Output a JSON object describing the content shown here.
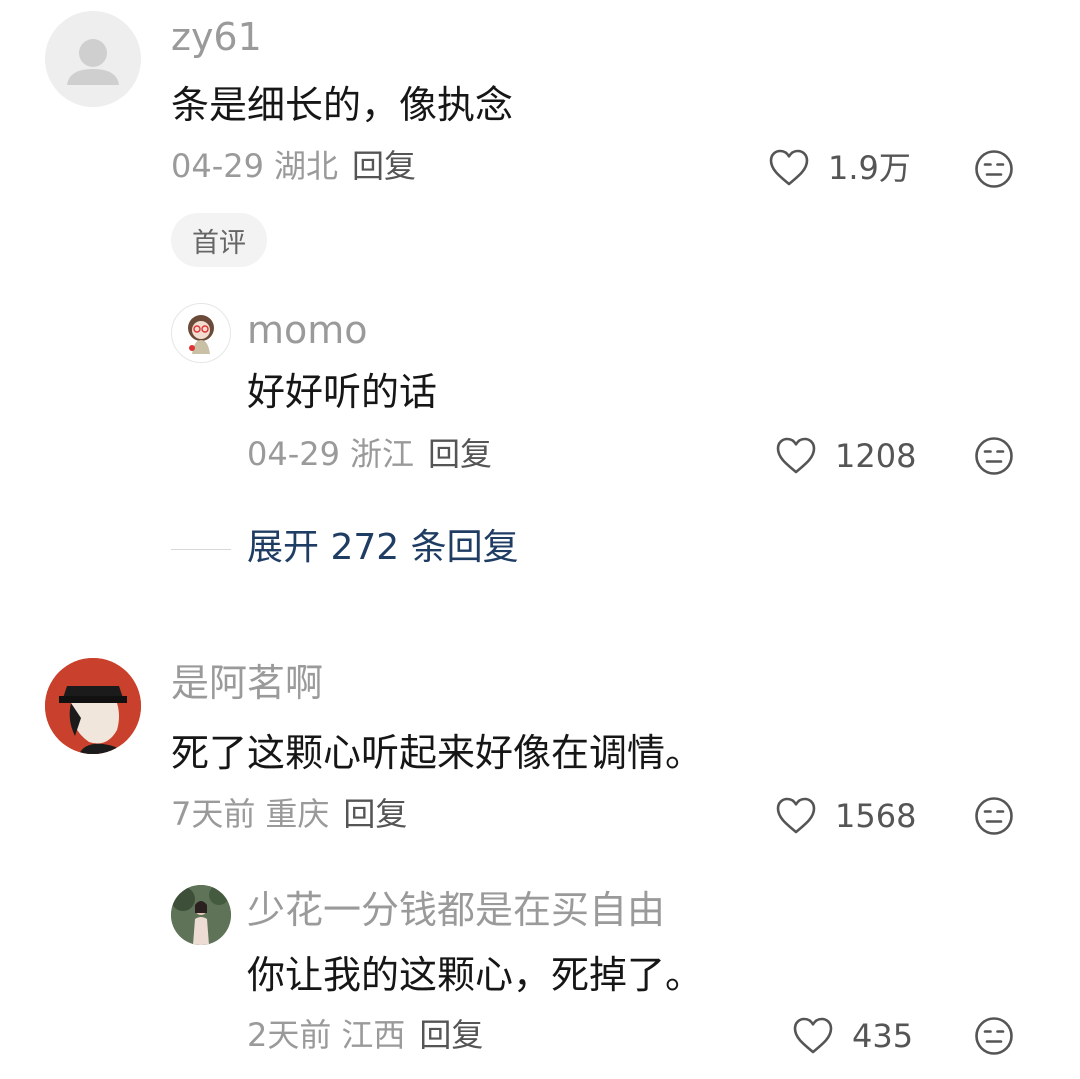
{
  "comments": [
    {
      "username": "zy61",
      "text": "条是细长的，像执念",
      "date": "04-29",
      "location": "湖北",
      "reply_label": "回复",
      "likes": "1.9万",
      "badge": "首评",
      "avatar": "default-avatar",
      "replies": [
        {
          "username": "momo",
          "text": "好好听的话",
          "date": "04-29",
          "location": "浙江",
          "reply_label": "回复",
          "likes": "1208",
          "avatar": "cartoon-girl-avatar"
        }
      ],
      "expand_label": "展开 272 条回复"
    },
    {
      "username": "是阿茗啊",
      "text": "死了这颗心听起来好像在调情。",
      "date": "7天前",
      "location": "重庆",
      "reply_label": "回复",
      "likes": "1568",
      "avatar": "illustrated-man-avatar",
      "replies": [
        {
          "username": "少花一分钱都是在买自由",
          "text": "你让我的这颗心，死掉了。",
          "date": "2天前",
          "location": "江西",
          "reply_label": "回复",
          "likes": "435",
          "avatar": "photo-avatar"
        }
      ]
    }
  ],
  "colors": {
    "username": "#9a9a9a",
    "content": "#161616",
    "meta": "#9a9a9a",
    "expand_link": "#1f3c63",
    "icon": "#555555"
  },
  "icons": {
    "like": "heart-outline-icon",
    "dislike": "neutral-face-icon"
  }
}
